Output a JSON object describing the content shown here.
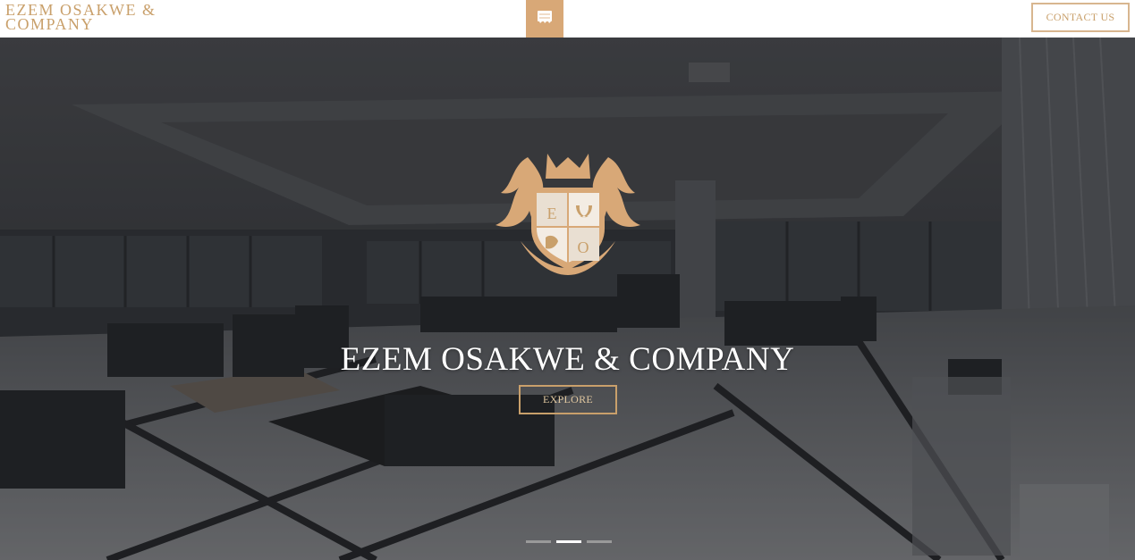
{
  "header": {
    "brand": "EZEM OSAKWE & COMPANY",
    "menu_icon": "menu-icon",
    "contact_label": "CONTACT US"
  },
  "hero": {
    "title": "EZEM OSAKWE & COMPANY",
    "explore_label": "EXPLORE",
    "crest": {
      "top_left": "E",
      "bottom_right": "O"
    },
    "slider": {
      "count": 3,
      "active_index": 1
    }
  },
  "colors": {
    "accent": "#d8a877",
    "brand_text": "#c9a06b",
    "overlay": "#3f4043"
  }
}
